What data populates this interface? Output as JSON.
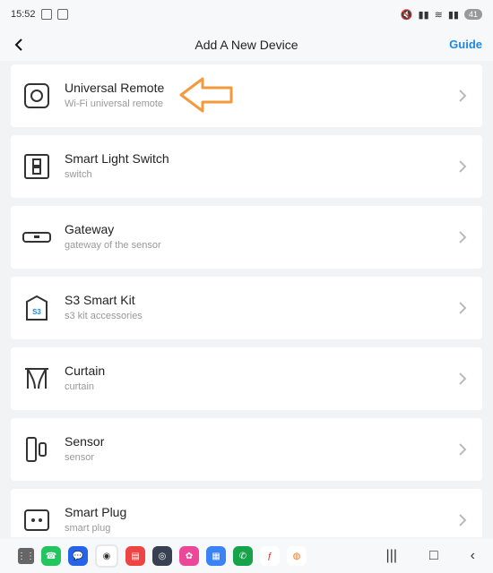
{
  "status": {
    "time": "15:52",
    "battery": "41"
  },
  "header": {
    "title": "Add A New Device",
    "guide": "Guide"
  },
  "devices": [
    {
      "name": "Universal Remote",
      "sub": "Wi-Fi universal remote",
      "icon": "universal-remote-icon"
    },
    {
      "name": "Smart Light Switch",
      "sub": "switch",
      "icon": "light-switch-icon"
    },
    {
      "name": "Gateway",
      "sub": "gateway of the sensor",
      "icon": "gateway-icon"
    },
    {
      "name": "S3 Smart Kit",
      "sub": "s3 kit accessories",
      "icon": "kit-box-icon",
      "badge": "S3"
    },
    {
      "name": "Curtain",
      "sub": "curtain",
      "icon": "curtain-icon"
    },
    {
      "name": "Sensor",
      "sub": "sensor",
      "icon": "sensor-icon"
    },
    {
      "name": "Smart Plug",
      "sub": "smart plug",
      "icon": "smart-plug-icon"
    }
  ],
  "colors": {
    "accent": "#1e88e5",
    "callout": "#f39a3c"
  }
}
